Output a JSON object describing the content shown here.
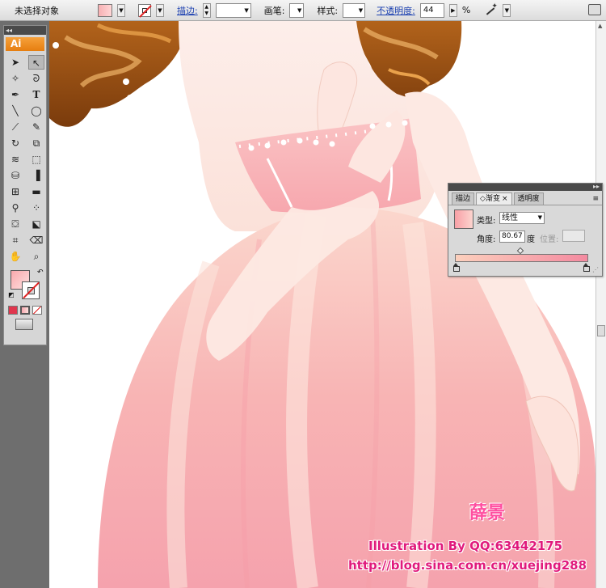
{
  "control_bar": {
    "selection_status": "未选择对象",
    "stroke_label": "描边:",
    "brush_label": "画笔:",
    "style_label": "样式:",
    "opacity_label": "不透明度:",
    "opacity_value": "44",
    "opacity_unit": "%"
  },
  "tools": {
    "logo": "Ai"
  },
  "gradient_panel": {
    "tabs": [
      "描边",
      "渐变",
      "透明度"
    ],
    "type_label": "类型:",
    "type_value": "线性",
    "angle_label": "角度:",
    "angle_value": "80.67",
    "degree_label": "度",
    "location_label": "位置:",
    "location_value": "",
    "start_color": "#fcd0bd",
    "end_color": "#f48aa0"
  },
  "watermark": {
    "name_cn": "薛景",
    "line1": "Illustration By QQ:63442175",
    "line2": "http://blog.sina.com.cn/xuejing288"
  }
}
